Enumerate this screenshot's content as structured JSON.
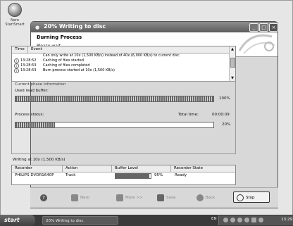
{
  "desktop": {
    "icon_label": "Nero StartSmart"
  },
  "window": {
    "title": "20% Writing to disc"
  },
  "header": {
    "title": "Burning Process",
    "subtitle": "Please wait..."
  },
  "log": {
    "col_time": "Time",
    "col_event": "Event",
    "rows": [
      {
        "time": "",
        "text": "Can only write at 10x (1,500 KB/s) instead of 40x (6,000 KB/s) to current disc."
      },
      {
        "time": "13:28:52",
        "text": "Caching of files started"
      },
      {
        "time": "13:28:53",
        "text": "Caching of files completed"
      },
      {
        "time": "13:28:53",
        "text": "Burn process started at 10x (1,500 KB/s)"
      }
    ]
  },
  "phase": {
    "group_label": "Current phase information",
    "buffer_label": "Used read buffer:",
    "buffer_percent": "100%",
    "buffer_value": 1.0,
    "status_label": "Process status:",
    "total_time_label": "Total time:",
    "total_time": "00:00:09",
    "status_percent": "20%",
    "status_value": 0.2,
    "speed_text": "Writing at 10x (1,500 KB/s)"
  },
  "recorder": {
    "headers": [
      "Recorder",
      "Action",
      "Buffer Level",
      "Recorder State"
    ],
    "row": {
      "name": "PHILIPS DVDR1640P",
      "action": "Track",
      "buffer": "95%",
      "buffer_value": 0.95,
      "state": "Ready"
    }
  },
  "footer": {
    "nero_label": "Nero",
    "more_label": "More >>",
    "save_label": "Save",
    "back_label": "Back",
    "stop_label": "Stop"
  },
  "taskbar": {
    "start_label": "start",
    "task_label": "20% Writing to disc",
    "lang": "EN",
    "clock": "13:29"
  },
  "colors": {
    "window_bg": "#d8d8d8",
    "titlebar": "#6e6e6e",
    "taskbar": "#3a3a3a"
  }
}
